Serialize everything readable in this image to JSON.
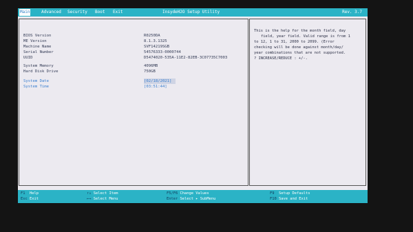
{
  "menu": {
    "tabs": [
      {
        "label": "Main",
        "active": true
      },
      {
        "label": "Advanced",
        "active": false
      },
      {
        "label": "Security",
        "active": false
      },
      {
        "label": "Boot",
        "active": false
      },
      {
        "label": "Exit",
        "active": false
      }
    ],
    "title": "InsydeH2O Setup Utility",
    "revision": "Rev. 3.7"
  },
  "info": [
    {
      "label": "BIOS Version",
      "value": "R0250DA"
    },
    {
      "label": "ME Version",
      "value": "8.1.3.1325"
    },
    {
      "label": "Machine Name",
      "value": "SVF14219SGB"
    },
    {
      "label": "Serial Number",
      "value": "54576333-0000744"
    },
    {
      "label": "UUID",
      "value": "D5474020-535A-11E2-82EB-3C07735C7003"
    }
  ],
  "memory": [
    {
      "label": "System Memory",
      "value": "4096MB"
    },
    {
      "label": "Hard Disk Drive",
      "value": "750GB"
    }
  ],
  "datetime": [
    {
      "label": "System Date",
      "value": "[02/18/2021]"
    },
    {
      "label": "System Time",
      "value": "[03:51:44]"
    }
  ],
  "help": {
    "lines": [
      "This is the help for the month field, day",
      "field, year field. Valid range is from 1",
      "to 12, 1 to 31, 2000 to 2099. (Error",
      "checking will be done against month/day/",
      "year combinations that are not supported.",
      "? INCREASE/REDUCE : +/-."
    ]
  },
  "footer": [
    {
      "key": "F1",
      "label": "Help"
    },
    {
      "key": "Esc",
      "label": "Exit"
    },
    {
      "key": "↑↓",
      "label": "Select Item"
    },
    {
      "key": "←→",
      "label": "Select Menu"
    },
    {
      "key": "F5/F6",
      "label": "Change Values"
    },
    {
      "key": "Enter",
      "label": "Select ▸ SubMenu"
    },
    {
      "key": "F9",
      "label": "Setup Defaults"
    },
    {
      "key": "F10",
      "label": "Save and Exit"
    }
  ],
  "colors": {
    "bar": "#2bb3c6",
    "panel": "#eceaf0",
    "highlight": "#3a7fd0"
  }
}
